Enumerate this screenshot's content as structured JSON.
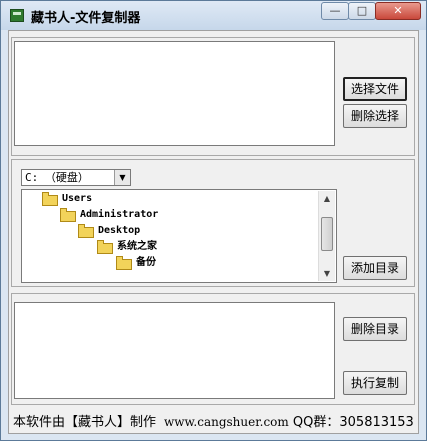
{
  "window": {
    "title": "藏书人-文件复制器",
    "min_icon": "minimize-icon",
    "max_icon": "maximize-icon",
    "close_icon": "close-icon",
    "min_glyph": "—",
    "max_glyph": "□",
    "close_glyph": "✕"
  },
  "buttons": {
    "select_file": "选择文件",
    "delete_selection": "删除选择",
    "add_directory": "添加目录",
    "delete_directory": "删除目录",
    "execute_copy": "执行复制"
  },
  "drive_combo": {
    "selected": "C: （硬盘）",
    "arrow": "▼"
  },
  "tree": {
    "nodes": [
      {
        "label": "Users"
      },
      {
        "label": "Administrator"
      },
      {
        "label": "Desktop"
      },
      {
        "label": "系统之家"
      },
      {
        "label": "备份"
      }
    ],
    "scroll_up": "▲",
    "scroll_down": "▼"
  },
  "status": {
    "credit": "本软件由【藏书人】制作",
    "website": "www.cangshuer.com",
    "qq": "QQ群：305813153"
  },
  "colors": {
    "accent": "#c9483b",
    "folder": "#f2d35a"
  }
}
